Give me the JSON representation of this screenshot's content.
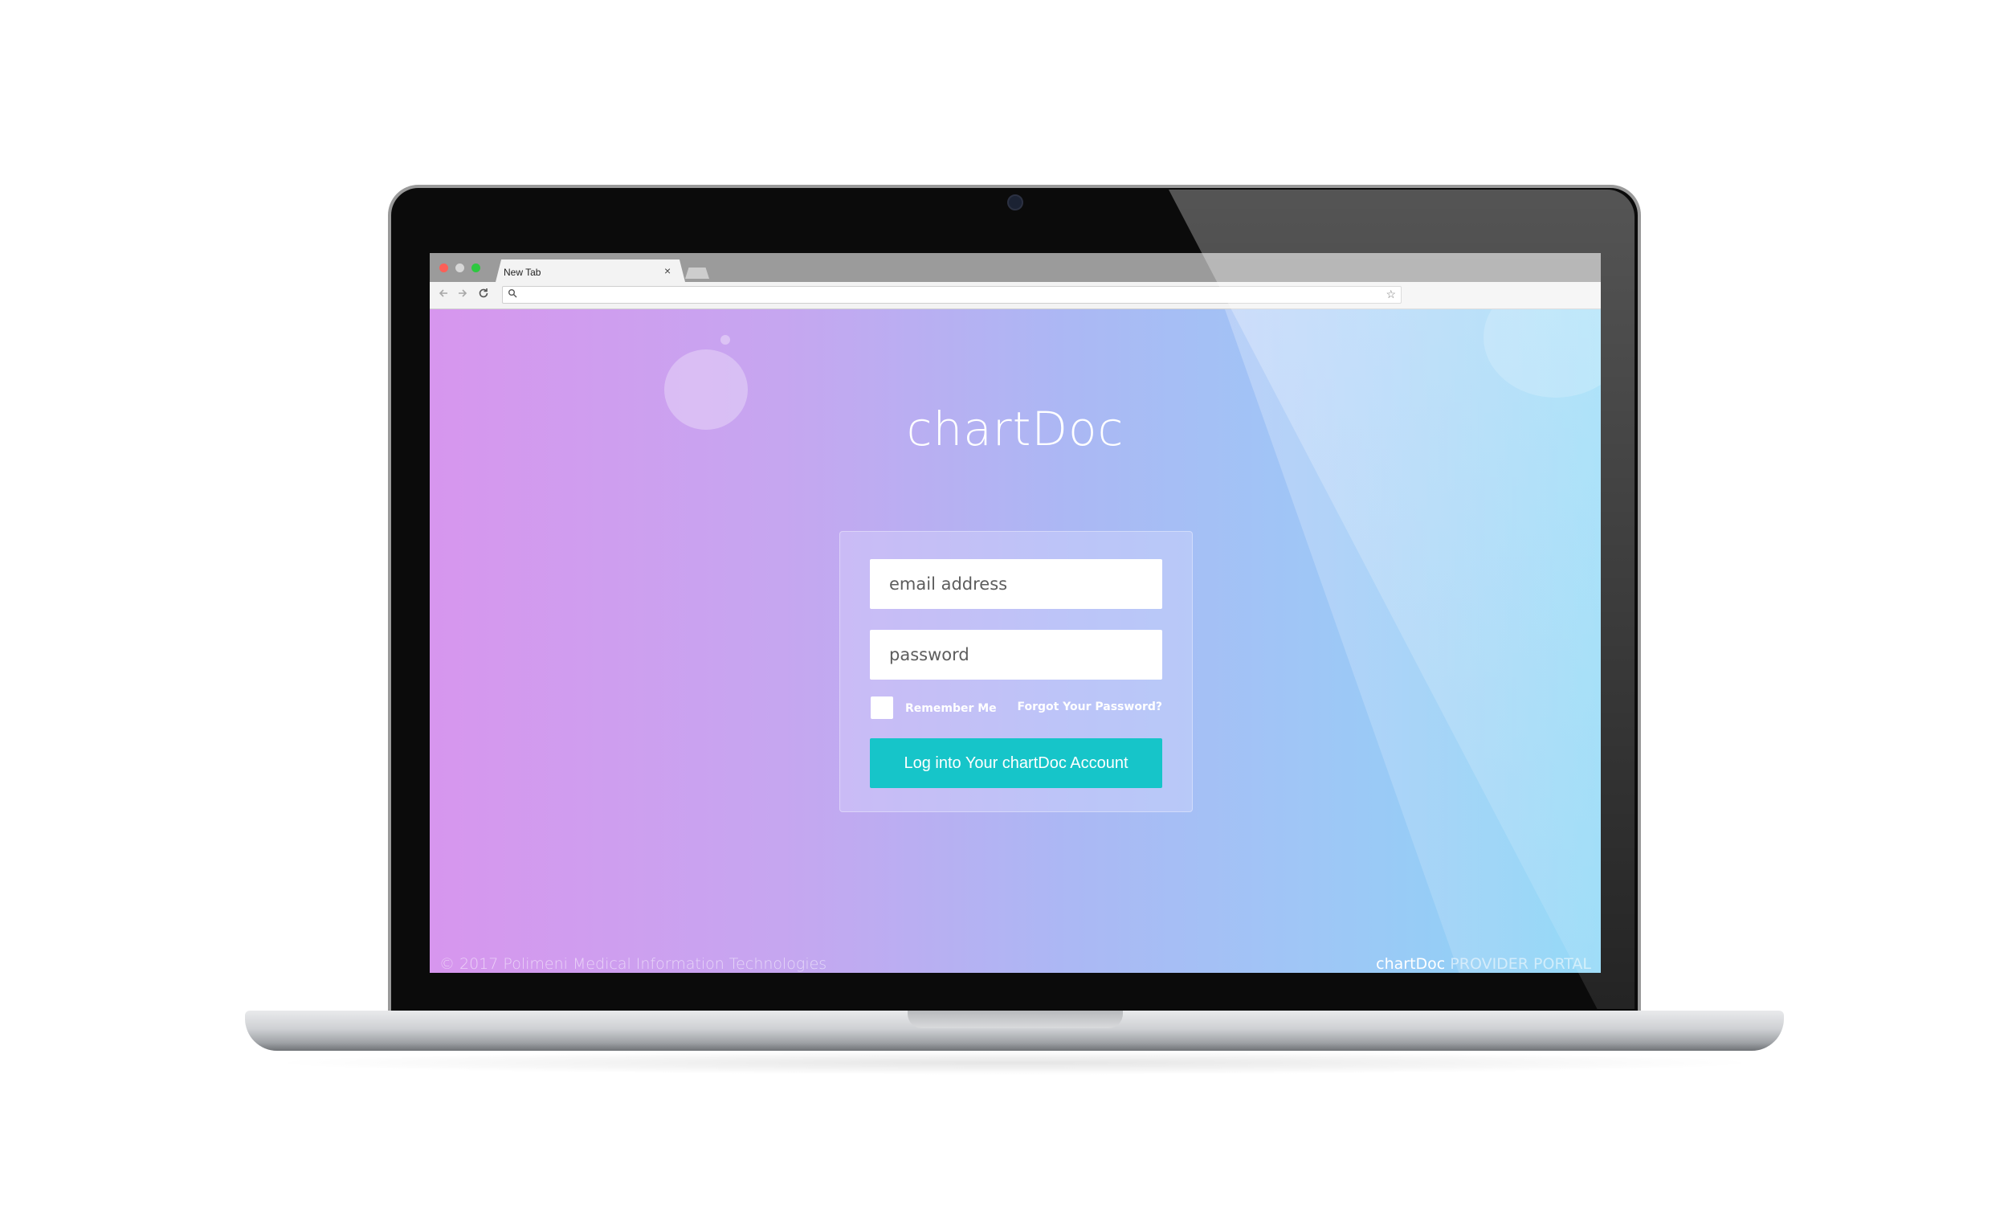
{
  "browser": {
    "tab_title": "New Tab",
    "tab_close": "×",
    "url": "",
    "icons": {
      "back": "arrow-left-icon",
      "forward": "arrow-right-icon",
      "reload": "reload-icon",
      "search": "search-icon",
      "bookmark": "star-icon"
    }
  },
  "login": {
    "logo": "chartDoc",
    "email_placeholder": "email address",
    "password_placeholder": "password",
    "remember_label": "Remember Me",
    "forgot_label": "Forgot Your Password?",
    "submit_label": "Log into Your chartDoc Account"
  },
  "footer": {
    "copyright": "© 2017 Polimeni Medical Information Technologies",
    "portal_brand": "chartDoc",
    "portal_tag": " PROVIDER PORTAL"
  },
  "colors": {
    "accent": "#16c5c9",
    "gradient_start": "#d796ee",
    "gradient_end": "#8ad6f6"
  }
}
